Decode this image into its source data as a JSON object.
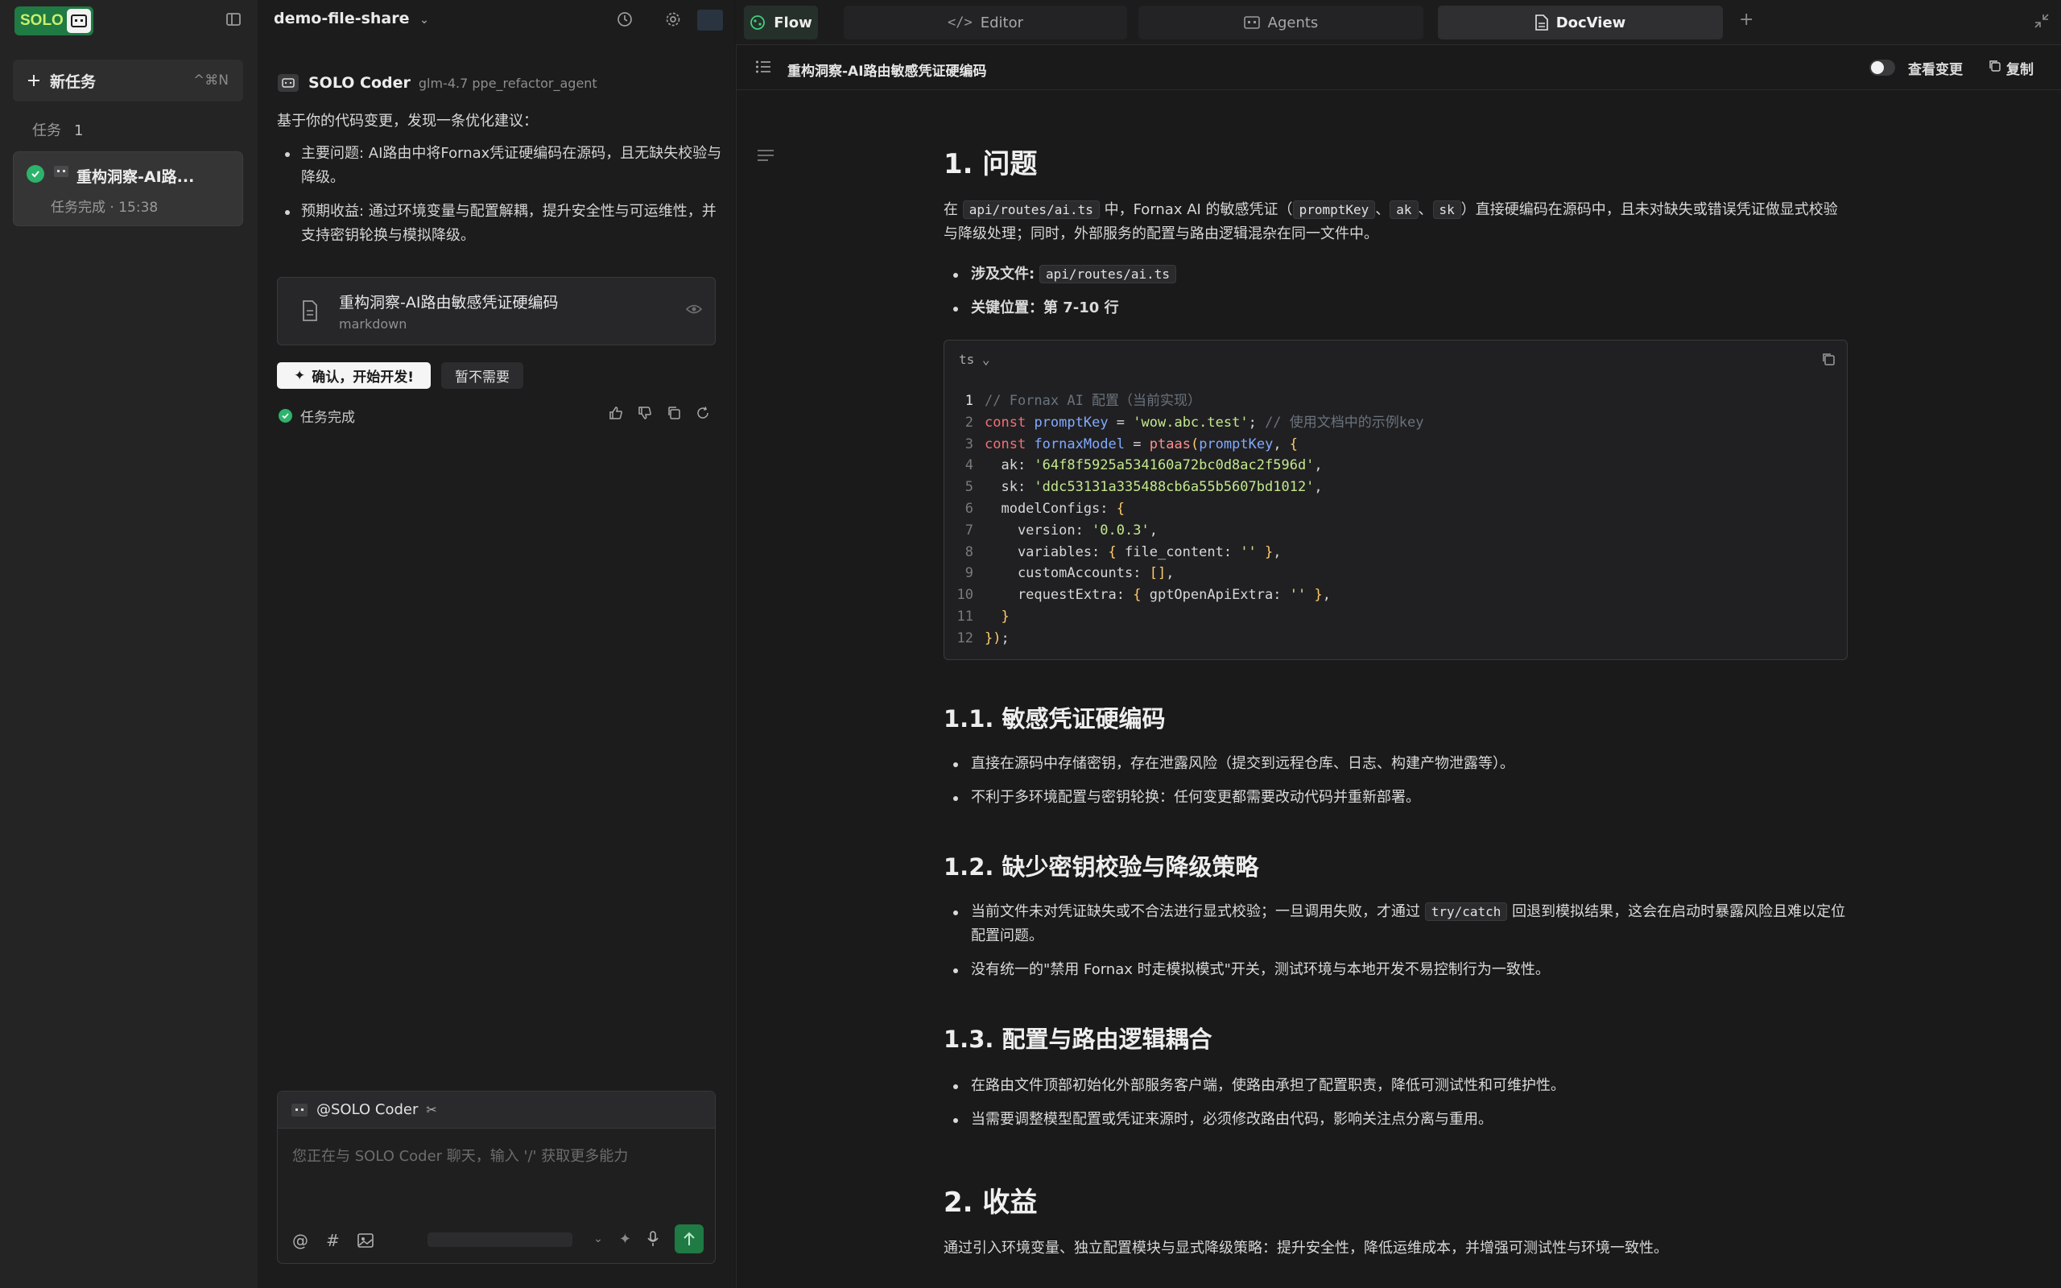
{
  "logo": {
    "text": "SOLO"
  },
  "sidebar": {
    "new_task": "新任务",
    "new_task_shortcut": "^⌘N",
    "section_label": "任务",
    "section_count": "1",
    "task": {
      "title": "重构洞察-AI路...",
      "meta": "任务完成 · 15:38"
    }
  },
  "chat": {
    "project": "demo-file-share",
    "agent_name": "SOLO Coder",
    "agent_model": "glm-4.7 ppe_refactor_agent",
    "intro": "基于你的代码变更，发现一条优化建议：",
    "bullets": [
      "主要问题: AI路由中将Fornax凭证硬编码在源码，且无缺失校验与降级。",
      "预期收益: 通过环境变量与配置解耦，提升安全性与可运维性，并支持密钥轮换与模拟降级。"
    ],
    "doc_card": {
      "title": "重构洞察-AI路由敏感凭证硬编码",
      "subtitle": "markdown"
    },
    "confirm_btn": "确认，开始开发!",
    "skip_btn": "暂不需要",
    "status": "任务完成",
    "composer": {
      "mention": "@SOLO Coder",
      "placeholder": "您正在与 SOLO Coder 聊天，输入 '/' 获取更多能力"
    }
  },
  "tabs": [
    {
      "label": "Flow",
      "icon": "flow-icon"
    },
    {
      "label": "Editor",
      "icon": "code-icon"
    },
    {
      "label": "Agents",
      "icon": "agents-icon"
    },
    {
      "label": "DocView",
      "icon": "doc-icon"
    }
  ],
  "doc": {
    "title": "重构洞察-AI路由敏感凭证硬编码",
    "view_changes": "查看变更",
    "copy": "复制",
    "h1_problem": "1. 问题",
    "problem_para": {
      "p1": "在",
      "file": "api/routes/ai.ts",
      "p2": "中，Fornax AI 的敏感凭证（",
      "k1": "promptKey",
      "sep1": "、",
      "k2": "ak",
      "sep2": "、",
      "k3": "sk",
      "p3": "）直接硬编码在源码中，且未对缺失或错误凭证做显式校验与降级处理；同时，外部服务的配置与路由逻辑混杂在同一文件中。"
    },
    "file_label": "涉及文件:",
    "file_value": "api/routes/ai.ts",
    "location": "关键位置：第 7-10 行",
    "code_lang": "ts",
    "h2_1": "1.1. 敏感凭证硬编码",
    "list_1": [
      "直接在源码中存储密钥，存在泄露风险（提交到远程仓库、日志、构建产物泄露等）。",
      "不利于多环境配置与密钥轮换：任何变更都需要改动代码并重新部署。"
    ],
    "h2_2": "1.2. 缺少密钥校验与降级策略",
    "list_2_a1": "当前文件未对凭证缺失或不合法进行显式校验；一旦调用失败，才通过",
    "list_2_code": "try/catch",
    "list_2_a2": "回退到模拟结果，这会在启动时暴露风险且难以定位配置问题。",
    "list_2_b": "没有统一的\"禁用 Fornax 时走模拟模式\"开关，测试环境与本地开发不易控制行为一致性。",
    "h2_3": "1.3. 配置与路由逻辑耦合",
    "list_3": [
      "在路由文件顶部初始化外部服务客户端，使路由承担了配置职责，降低可测试性和可维护性。",
      "当需要调整模型配置或凭证来源时，必须修改路由代码，影响关注点分离与重用。"
    ],
    "h1_benefit": "2. 收益",
    "benefit_para": "通过引入环境变量、独立配置模块与显式降级策略：提升安全性，降低运维成本，并增强可测试性与环境一致性。"
  },
  "code_lines": [
    "// Fornax AI 配置（当前实现）",
    "const promptKey = 'wow.abc.test'; // 使用文档中的示例key",
    "const fornaxModel = ptaas(promptKey, {",
    "  ak: '64f8f5925a534160a72bc0d8ac2f596d',",
    "  sk: 'ddc53131a335488cb6a55b5607bd1012',",
    "  modelConfigs: {",
    "    version: '0.0.3',",
    "    variables: { file_content: '' },",
    "    customAccounts: [],",
    "    requestExtra: { gptOpenApiExtra: '' },",
    "  }",
    "});"
  ]
}
